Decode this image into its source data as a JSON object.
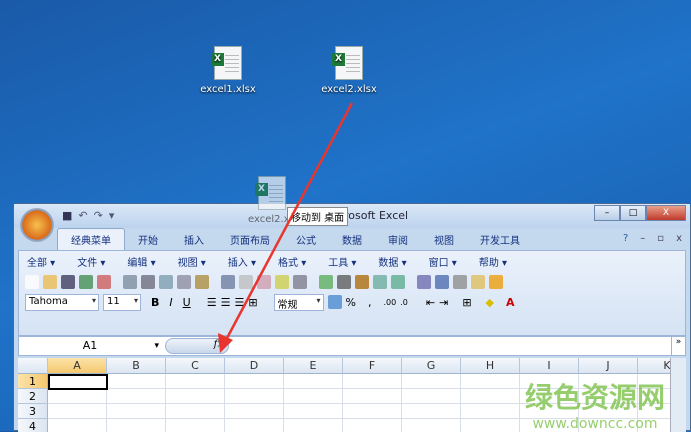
{
  "desktop": {
    "icons": [
      {
        "label": "excel1.xlsx"
      },
      {
        "label": "excel2.xlsx"
      }
    ],
    "drag_label": "excel2.xlsx",
    "drag_tooltip": "移动到 桌面"
  },
  "window": {
    "title": "rosoft Excel",
    "buttons": [
      "–",
      "□",
      "X"
    ]
  },
  "ribbon_tabs": [
    "经典菜单",
    "开始",
    "插入",
    "页面布局",
    "公式",
    "数据",
    "审阅",
    "视图",
    "开发工具"
  ],
  "active_tab": "经典菜单",
  "menu": [
    "全部 ▾",
    "文件 ▾",
    "编辑 ▾",
    "视图 ▾",
    "插入 ▾",
    "格式 ▾",
    "工具 ▾",
    "数据 ▾",
    "窗口 ▾",
    "帮助 ▾"
  ],
  "toolbar": {
    "font": "Tahoma",
    "size": "11",
    "bold": "B",
    "italic": "I",
    "underline": "U",
    "number_format": "常规",
    "percent": "%",
    "comma": ","
  },
  "formula_bar": {
    "name_box": "A1",
    "fx": "fx",
    "value": ""
  },
  "columns": [
    "A",
    "B",
    "C",
    "D",
    "E",
    "F",
    "G",
    "H",
    "I",
    "J",
    "K"
  ],
  "rows": [
    "1",
    "2",
    "3",
    "4"
  ],
  "watermark": {
    "title": "绿色资源网",
    "url": "www.downcc.com"
  }
}
